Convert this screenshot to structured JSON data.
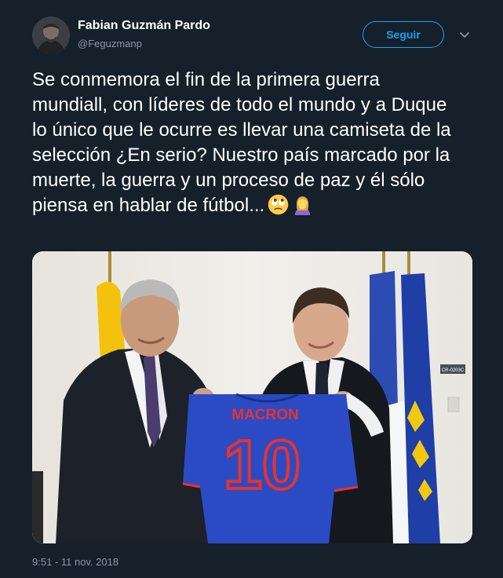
{
  "author": {
    "display_name": "Fabian Guzmán Pardo",
    "handle": "@Feguzmanp"
  },
  "follow_button": {
    "label": "Seguir"
  },
  "more_menu": {
    "icon": "chevron-down-icon"
  },
  "tweet": {
    "text": "Se conmemora el fin de la primera guerra mundiall, con líderes de todo el mundo y a Duque lo único que le ocurre es llevar una camiseta de la selección ¿En serio? Nuestro país marcado por la muerte, la guerra y un proceso de paz y él sólo piensa en hablar de fútbol...",
    "emojis": [
      "face-with-rolling-eyes-emoji",
      "woman-facepalming-emoji"
    ]
  },
  "media": {
    "jersey_name": "MACRON",
    "jersey_number": "10",
    "wall_sign": "CR-0203C"
  },
  "timestamp": "9:51 - 11 nov. 2018",
  "colors": {
    "background": "#15202b",
    "accent": "#1da1f2",
    "secondary_text": "#8899a6",
    "jersey": "#2b4bc4",
    "jersey_text": "#e8322c"
  }
}
